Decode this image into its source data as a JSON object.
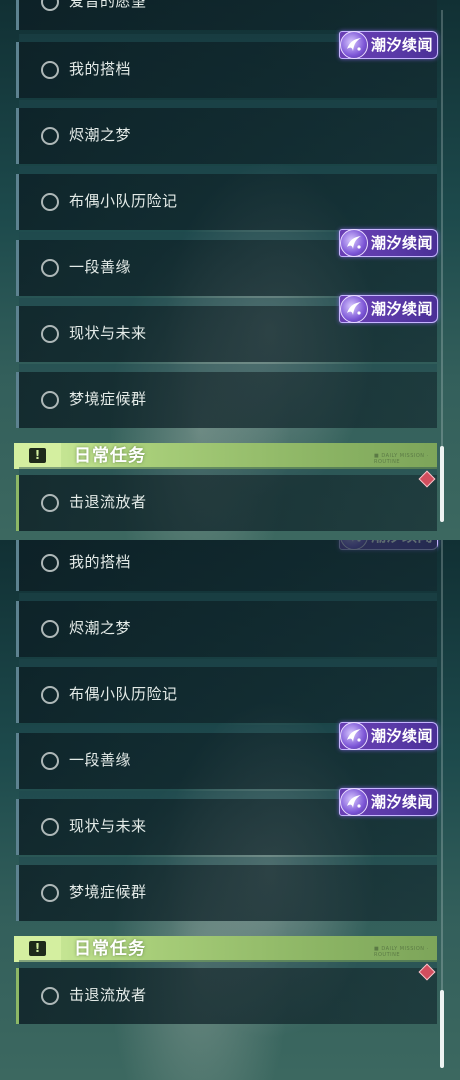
{
  "top_panel": {
    "partial_quest": "爱音的愿望",
    "quests": [
      "我的搭档",
      "烬潮之梦",
      "布偶小队历险记",
      "一段善缘",
      "现状与未来",
      "梦境症候群"
    ],
    "badge_label": "潮汐续闻",
    "section_title": "日常任务",
    "section_deco": "■ DAILY MISSION · ROUTINE",
    "daily_quest": "击退流放者"
  },
  "bottom_panel": {
    "quests": [
      "我的搭档",
      "烬潮之梦",
      "布偶小队历险记",
      "一段善缘",
      "现状与未来",
      "梦境症候群"
    ],
    "badge_label": "潮汐续闻",
    "section_title": "日常任务",
    "section_deco": "■ DAILY MISSION · ROUTINE",
    "daily_quest": "击退流放者"
  },
  "icons": {
    "quest_status": "empty-circle-icon",
    "badge_emblem": "tide-emblem-icon",
    "section": "exclamation-box-icon",
    "tracked": "red-diamond-icon"
  },
  "colors": {
    "badge_bg": "#5a3aa8",
    "section_header": "#a9cf7a",
    "quest_accent": "#5d8290",
    "daily_accent": "#8db866",
    "marker": "#d24e5e"
  }
}
